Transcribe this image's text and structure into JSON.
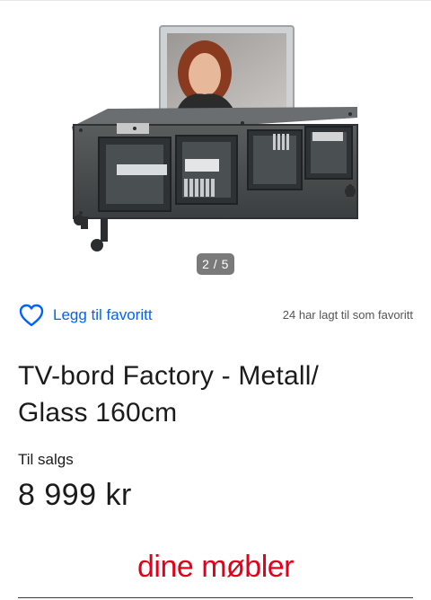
{
  "gallery": {
    "image_alt": "TV-bord Factory - Metall/Glass 160cm",
    "counter": "2 / 5"
  },
  "favorite": {
    "label": "Legg til favoritt",
    "count_text": "24 har lagt til som favoritt",
    "icon": "heart-outline-icon",
    "color": "#0063fb"
  },
  "listing": {
    "title_line1": "TV-bord Factory - Metall/",
    "title_line2": "Glass 160cm",
    "status": "Til salgs",
    "price": "8 999 kr"
  },
  "brand": {
    "name": "dine møbler",
    "color": "#e3001b"
  }
}
